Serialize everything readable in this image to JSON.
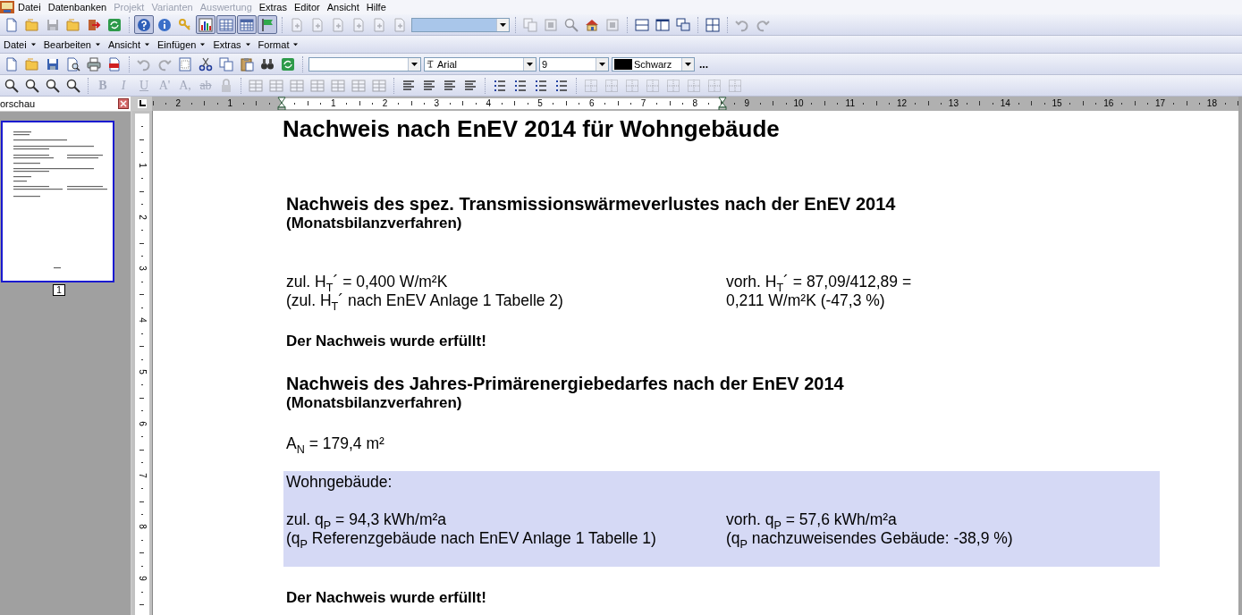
{
  "menu_bar": {
    "items": [
      {
        "label": "Datei",
        "disabled": false
      },
      {
        "label": "Datenbanken",
        "disabled": false
      },
      {
        "label": "Projekt",
        "disabled": true
      },
      {
        "label": "Varianten",
        "disabled": true
      },
      {
        "label": "Auswertung",
        "disabled": true
      },
      {
        "label": "Extras",
        "disabled": false
      },
      {
        "label": "Editor",
        "disabled": false
      },
      {
        "label": "Ansicht",
        "disabled": false
      },
      {
        "label": "Hilfe",
        "disabled": false
      }
    ]
  },
  "main_toolbar": {
    "items": [
      {
        "kind": "button",
        "disabled": false,
        "pressed": false
      },
      {
        "kind": "button",
        "disabled": false,
        "pressed": false
      },
      {
        "kind": "button",
        "disabled": true,
        "pressed": false
      },
      {
        "kind": "button",
        "disabled": false,
        "pressed": false
      },
      {
        "kind": "button",
        "disabled": false,
        "pressed": false
      },
      {
        "kind": "button",
        "disabled": false,
        "pressed": false
      },
      {
        "kind": "separator"
      },
      {
        "kind": "button",
        "disabled": false,
        "pressed": true
      },
      {
        "kind": "button",
        "disabled": false,
        "pressed": false
      },
      {
        "kind": "button",
        "disabled": false,
        "pressed": false
      },
      {
        "kind": "button",
        "disabled": false,
        "pressed": true
      },
      {
        "kind": "button",
        "disabled": false,
        "pressed": true
      },
      {
        "kind": "button",
        "disabled": false,
        "pressed": true
      },
      {
        "kind": "button",
        "disabled": false,
        "pressed": true
      },
      {
        "kind": "separator"
      },
      {
        "kind": "button",
        "disabled": true,
        "pressed": false
      },
      {
        "kind": "button",
        "disabled": true,
        "pressed": false
      },
      {
        "kind": "button",
        "disabled": true,
        "pressed": false
      },
      {
        "kind": "button",
        "disabled": true,
        "pressed": false
      },
      {
        "kind": "button",
        "disabled": true,
        "pressed": false
      },
      {
        "kind": "button",
        "disabled": true,
        "pressed": false
      },
      {
        "kind": "combo",
        "disabled": true
      },
      {
        "kind": "separator"
      },
      {
        "kind": "button",
        "disabled": true,
        "pressed": false
      },
      {
        "kind": "button",
        "disabled": true,
        "pressed": false
      },
      {
        "kind": "button",
        "disabled": true,
        "pressed": false
      },
      {
        "kind": "button",
        "disabled": false,
        "pressed": false
      },
      {
        "kind": "button",
        "disabled": true,
        "pressed": false
      },
      {
        "kind": "separator"
      },
      {
        "kind": "button",
        "disabled": false,
        "pressed": false
      },
      {
        "kind": "button",
        "disabled": false,
        "pressed": false
      },
      {
        "kind": "button",
        "disabled": false,
        "pressed": false
      },
      {
        "kind": "separator"
      },
      {
        "kind": "button",
        "disabled": false,
        "pressed": false
      },
      {
        "kind": "separator"
      },
      {
        "kind": "button",
        "disabled": true,
        "pressed": false
      },
      {
        "kind": "button",
        "disabled": true,
        "pressed": false
      }
    ]
  },
  "editor_menu": {
    "items": [
      "Datei",
      "Bearbeiten",
      "Ansicht",
      "Einfügen",
      "Extras",
      "Format"
    ]
  },
  "editor_toolbars": [
    {
      "items": [
        {
          "kind": "button",
          "disabled": false,
          "pressed": false
        },
        {
          "kind": "button",
          "disabled": false,
          "pressed": false
        },
        {
          "kind": "button",
          "disabled": false,
          "pressed": false
        },
        {
          "kind": "button",
          "disabled": false,
          "pressed": false
        },
        {
          "kind": "button",
          "disabled": false,
          "pressed": false
        },
        {
          "kind": "button",
          "disabled": false,
          "pressed": false
        },
        {
          "kind": "separator"
        },
        {
          "kind": "button",
          "disabled": true,
          "pressed": false
        },
        {
          "kind": "button",
          "disabled": true,
          "pressed": false
        },
        {
          "kind": "button",
          "disabled": false,
          "pressed": false
        },
        {
          "kind": "button",
          "disabled": false,
          "pressed": false
        },
        {
          "kind": "button",
          "disabled": false,
          "pressed": false
        },
        {
          "kind": "button",
          "disabled": false,
          "pressed": false
        },
        {
          "kind": "button",
          "disabled": false,
          "pressed": false
        },
        {
          "kind": "button",
          "disabled": false,
          "pressed": false
        },
        {
          "kind": "separator"
        },
        {
          "kind": "combo",
          "disabled": false
        },
        {
          "kind": "font-combo",
          "disabled": false,
          "value": "Arial"
        },
        {
          "kind": "combo",
          "disabled": false,
          "value": "9"
        },
        {
          "kind": "color-combo",
          "disabled": false,
          "value": "Schwarz",
          "color": "#000000"
        },
        {
          "kind": "text-button",
          "text": "..."
        }
      ]
    },
    {
      "items": [
        {
          "kind": "button",
          "disabled": false,
          "pressed": false
        },
        {
          "kind": "button",
          "disabled": false,
          "pressed": false
        },
        {
          "kind": "button",
          "disabled": false,
          "pressed": false
        },
        {
          "kind": "button",
          "disabled": false,
          "pressed": false
        },
        {
          "kind": "separator"
        },
        {
          "kind": "glyph",
          "text": "B",
          "disabled": true,
          "pressed": false
        },
        {
          "kind": "glyph",
          "text": "I",
          "disabled": true,
          "pressed": false
        },
        {
          "kind": "glyph",
          "text": "U",
          "disabled": true,
          "pressed": false
        },
        {
          "kind": "glyph",
          "text": "A'",
          "disabled": true,
          "pressed": false
        },
        {
          "kind": "glyph",
          "text": "A,",
          "disabled": true,
          "pressed": false
        },
        {
          "kind": "glyph",
          "text": "ab",
          "disabled": true,
          "pressed": false
        },
        {
          "kind": "button",
          "disabled": true,
          "pressed": false
        },
        {
          "kind": "separator"
        },
        {
          "kind": "button",
          "disabled": true,
          "pressed": false
        },
        {
          "kind": "button",
          "disabled": true,
          "pressed": false
        },
        {
          "kind": "button",
          "disabled": true,
          "pressed": false
        },
        {
          "kind": "button",
          "disabled": true,
          "pressed": false
        },
        {
          "kind": "button",
          "disabled": true,
          "pressed": false
        },
        {
          "kind": "button",
          "disabled": true,
          "pressed": false
        },
        {
          "kind": "button",
          "disabled": true,
          "pressed": false
        },
        {
          "kind": "separator"
        },
        {
          "kind": "button",
          "disabled": false,
          "pressed": false
        },
        {
          "kind": "button",
          "disabled": false,
          "pressed": false
        },
        {
          "kind": "button",
          "disabled": false,
          "pressed": false
        },
        {
          "kind": "button",
          "disabled": false,
          "pressed": false
        },
        {
          "kind": "separator"
        },
        {
          "kind": "button",
          "disabled": false,
          "pressed": false
        },
        {
          "kind": "button",
          "disabled": false,
          "pressed": false
        },
        {
          "kind": "button",
          "disabled": false,
          "pressed": false
        },
        {
          "kind": "button",
          "disabled": false,
          "pressed": false
        },
        {
          "kind": "separator"
        },
        {
          "kind": "button",
          "disabled": true,
          "pressed": false
        },
        {
          "kind": "button",
          "disabled": true,
          "pressed": false
        },
        {
          "kind": "button",
          "disabled": true,
          "pressed": false
        },
        {
          "kind": "button",
          "disabled": true,
          "pressed": false
        },
        {
          "kind": "button",
          "disabled": true,
          "pressed": false
        },
        {
          "kind": "button",
          "disabled": true,
          "pressed": false
        },
        {
          "kind": "button",
          "disabled": true,
          "pressed": false
        },
        {
          "kind": "button",
          "disabled": true,
          "pressed": false
        }
      ]
    }
  ],
  "preview_panel": {
    "title": "orschau",
    "pages": [
      {
        "number": "1",
        "selected": true
      }
    ]
  },
  "ruler": {
    "left_numbers": [
      "2",
      "1"
    ],
    "numbers": [
      "1",
      "2",
      "3",
      "4",
      "5",
      "6",
      "7",
      "8",
      "9",
      "10",
      "11",
      "12",
      "13",
      "14",
      "15",
      "16",
      "17",
      "18"
    ]
  },
  "vertical_ruler": {
    "numbers": [
      "1",
      "2",
      "3",
      "4",
      "5",
      "6",
      "7",
      "8",
      "9"
    ]
  },
  "document": {
    "blocks": [
      {
        "kind": "title",
        "text": "Nachweis nach EnEV 2014 für Wohngebäude"
      },
      {
        "kind": "heading",
        "text": "Nachweis des spez. Transmissionswärmeverlustes nach der EnEV 2014"
      },
      {
        "kind": "subheading",
        "text": "(Monatsbilanzverfahren)"
      },
      {
        "kind": "pair",
        "left": [
          "zul. H$_{T}$´ = 0,400 W/m²K",
          "(zul. H$_{T}$´ nach EnEV Anlage 1 Tabelle 2)"
        ],
        "right": [
          "vorh. H$_{T}$´ = 87,09/412,89 =",
          "0,211 W/m²K (-47,3 %)"
        ]
      },
      {
        "kind": "result",
        "text": "Der Nachweis wurde erfüllt!"
      },
      {
        "kind": "heading",
        "text": "Nachweis des Jahres-Primärenergiebedarfes nach der EnEV 2014"
      },
      {
        "kind": "subheading",
        "text": "(Monatsbilanzverfahren)"
      },
      {
        "kind": "plain",
        "text": "A$_{N}$ = 179,4 m²"
      },
      {
        "kind": "highlight",
        "blocks": [
          {
            "kind": "plain",
            "text": "Wohngebäude:"
          },
          {
            "kind": "pair",
            "left": [
              "zul. q$_{P}$ = 94,3 kWh/m²a",
              "(q$_{P}$ Referenzgebäude nach EnEV Anlage 1 Tabelle 1)"
            ],
            "right": [
              "vorh. q$_{P}$ = 57,6 kWh/m²a",
              "(q$_{P}$ nachzuweisendes Gebäude: -38,9 %)"
            ]
          }
        ]
      },
      {
        "kind": "result",
        "text": "Der Nachweis wurde erfüllt!"
      }
    ]
  }
}
